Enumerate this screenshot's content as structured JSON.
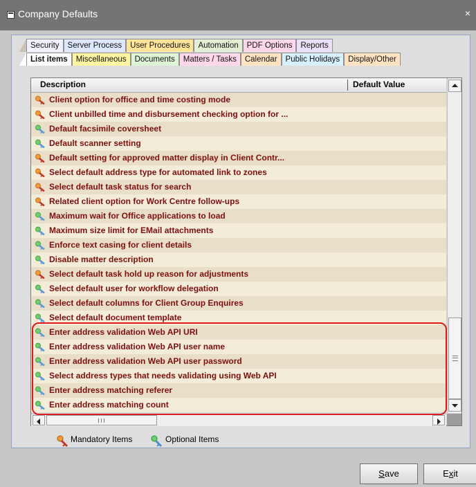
{
  "window": {
    "title": "Company Defaults",
    "close_glyph": "×"
  },
  "tabs_row1": [
    {
      "label": "Security",
      "color": "#f2f0ff"
    },
    {
      "label": "Server Process",
      "color": "#dde7ff"
    },
    {
      "label": "User Procedures",
      "color": "#ffe49a"
    },
    {
      "label": "Automation",
      "color": "#e2efd4"
    },
    {
      "label": "PDF Options",
      "color": "#ffd7ea"
    },
    {
      "label": "Reports",
      "color": "#ecdff8"
    }
  ],
  "tabs_row2": [
    {
      "label": "List items",
      "color": "#ffffff",
      "active": true
    },
    {
      "label": "Miscellaneous",
      "color": "#fff49f"
    },
    {
      "label": "Documents",
      "color": "#dff3d6"
    },
    {
      "label": "Matters / Tasks",
      "color": "#ffd7ea"
    },
    {
      "label": "Calendar",
      "color": "#ffe2c2"
    },
    {
      "label": "Public Holidays",
      "color": "#d7f0ff"
    },
    {
      "label": "Display/Other",
      "color": "#ffe2c2"
    }
  ],
  "list": {
    "col_description": "Description",
    "col_default": "Default Value",
    "rows": [
      {
        "text": "Client option for office and time costing mode",
        "type": "mandatory"
      },
      {
        "text": "Client unbilled time and disbursement checking option for ...",
        "type": "mandatory"
      },
      {
        "text": "Default facsimile coversheet",
        "type": "optional"
      },
      {
        "text": "Default scanner setting",
        "type": "optional"
      },
      {
        "text": "Default setting for approved matter display in Client Contr...",
        "type": "mandatory"
      },
      {
        "text": "Select default address type for automated link to zones",
        "type": "mandatory"
      },
      {
        "text": "Select default task status for search",
        "type": "mandatory"
      },
      {
        "text": "Related client option for Work Centre follow-ups",
        "type": "mandatory"
      },
      {
        "text": "Maximum wait for Office applications to load",
        "type": "optional"
      },
      {
        "text": "Maximum size limit for EMail attachments",
        "type": "optional"
      },
      {
        "text": "Enforce text casing for client details",
        "type": "optional"
      },
      {
        "text": "Disable matter description",
        "type": "optional"
      },
      {
        "text": "Select default task hold up reason for adjustments",
        "type": "mandatory"
      },
      {
        "text": "Select default user for workflow delegation",
        "type": "optional"
      },
      {
        "text": "Select default columns for Client Group Enquires",
        "type": "optional"
      },
      {
        "text": "Select default document template",
        "type": "optional"
      },
      {
        "text": "Enter address validation Web API URI",
        "type": "optional"
      },
      {
        "text": "Enter address validation Web API user name",
        "type": "optional"
      },
      {
        "text": "Enter address validation Web API user password",
        "type": "optional"
      },
      {
        "text": "Select address types that needs validating using Web API",
        "type": "optional"
      },
      {
        "text": "Enter address matching referer",
        "type": "optional"
      },
      {
        "text": "Enter address matching count",
        "type": "optional"
      }
    ]
  },
  "legend": {
    "mandatory": "Mandatory Items",
    "optional": "Optional Items"
  },
  "buttons": {
    "save_prefix": "S",
    "save_rest": "ave",
    "exit_prefix": "E",
    "exit_mid": "x",
    "exit_rest": "it"
  },
  "colors": {
    "row_text": "#7d0f0f",
    "highlight": "#e0191a",
    "mandatory_tip": "#f29b38",
    "optional_tip": "#6fcf6f"
  }
}
